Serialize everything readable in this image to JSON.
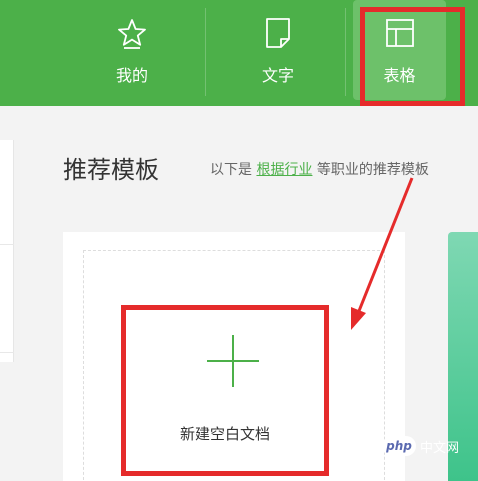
{
  "nav": {
    "tabs": [
      {
        "label": "我的",
        "icon": "star-icon"
      },
      {
        "label": "文字",
        "icon": "document-icon"
      },
      {
        "label": "表格",
        "icon": "table-icon",
        "active": true
      }
    ],
    "bg_color": "#4cb049",
    "active_color": "#6dc16a"
  },
  "main": {
    "section_title": "推荐模板",
    "hint_prefix": "以下是",
    "hint_link": "根据行业",
    "hint_suffix": "等职业的推荐模板",
    "blank_card_label": "新建空白文档"
  },
  "watermark": {
    "logo_text": "php",
    "site_text": "中文网"
  },
  "colors": {
    "accent": "#4cb049",
    "annotation": "#e52b2b",
    "template_green": "#3ec38a"
  }
}
